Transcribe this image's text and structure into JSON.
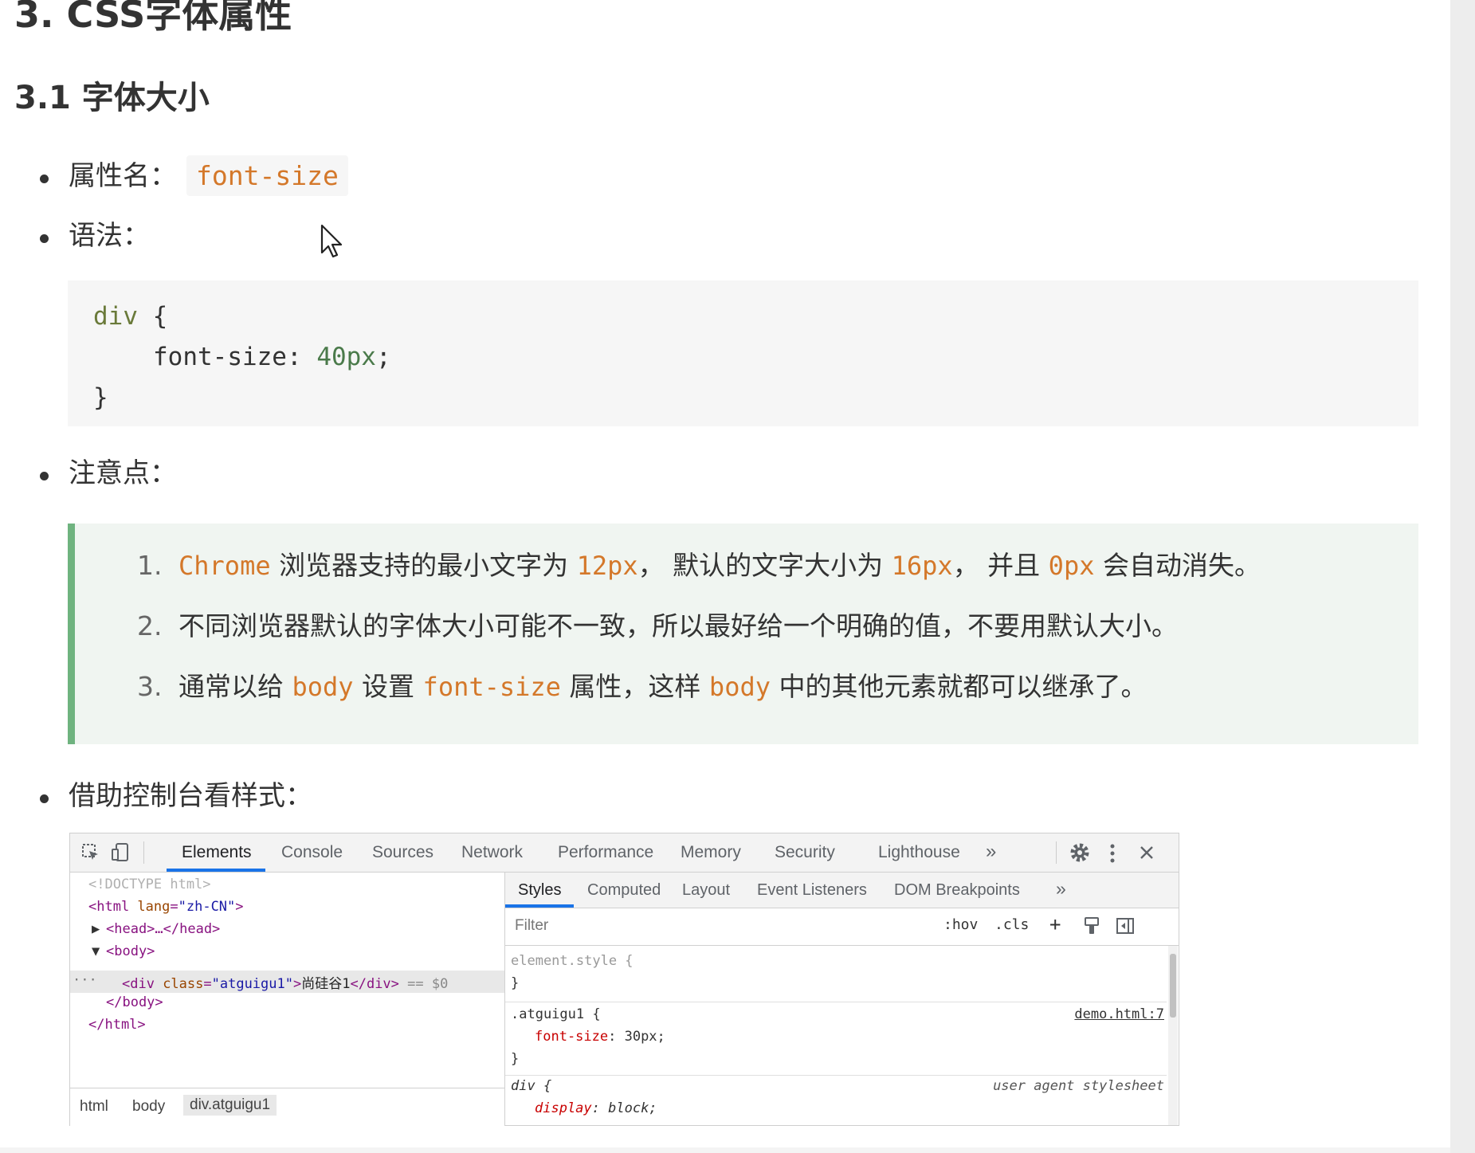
{
  "headings": {
    "h1": "3. CSS字体属性",
    "h2": "3.1 字体大小"
  },
  "bullets": {
    "prop_label": "属性名：",
    "prop_value": "font-size",
    "syntax_label": "语法：",
    "notes_label": "注意点：",
    "console_label": "借助控制台看样式："
  },
  "code": {
    "line1_kw": "div",
    "line1_rest": " {",
    "line2_prop": "font-size",
    "line2_colon": ": ",
    "line2_val": "40px",
    "line2_end": ";",
    "line3": "}"
  },
  "notes": [
    {
      "num": "1.",
      "a": "Chrome",
      "b": " 浏览器支持的最小文字为 ",
      "c": "12px",
      "d": "， 默认的文字大小为 ",
      "e": "16px",
      "f": "， 并且 ",
      "g": "0px",
      "h": " 会自动消失。"
    },
    {
      "num": "2.",
      "text": "不同浏览器默认的字体大小可能不一致，所以最好给一个明确的值，不要用默认大小。"
    },
    {
      "num": "3.",
      "a": "通常以给 ",
      "b": "body",
      "c": " 设置 ",
      "d": "font-size",
      "e": " 属性，这样 ",
      "f": "body",
      "g": " 中的其他元素就都可以继承了。"
    }
  ],
  "devtools": {
    "tabs": [
      "Elements",
      "Console",
      "Sources",
      "Network",
      "Performance",
      "Memory",
      "Security",
      "Lighthouse"
    ],
    "more": "»",
    "dom": {
      "doctype": "<!DOCTYPE html>",
      "html_open_tag": "<html ",
      "html_attr": "lang",
      "html_eq": "=",
      "html_val": "\"zh-CN\"",
      "html_close": ">",
      "head": "<head>…</head>",
      "body_open": "<body>",
      "div_tag": "<div ",
      "div_attr": "class",
      "div_eq": "=",
      "div_val": "\"atguigu1\"",
      "div_gt": ">",
      "div_text": "尚硅谷1",
      "div_close": "</div>",
      "div_marker": " == $0",
      "ellipsis": "···",
      "body_close": "</body>",
      "html_close_tag": "</html>"
    },
    "breadcrumbs": [
      "html",
      "body",
      "div.atguigu1"
    ],
    "subtabs": [
      "Styles",
      "Computed",
      "Layout",
      "Event Listeners",
      "DOM Breakpoints"
    ],
    "sub_more": "»",
    "filter_placeholder": "Filter",
    "hov": ":hov",
    "cls": ".cls",
    "plus": "+",
    "rules": {
      "element_style": "element.style {",
      "close1": "}",
      "selector2": ".atguigu1 {",
      "source2": "demo.html:7",
      "prop2": "font-size",
      "val2": ": 30px;",
      "close2": "}",
      "selector3": "div {",
      "source3": "user agent stylesheet",
      "prop3": "display",
      "val3": ": block;"
    }
  },
  "colors": {
    "code_orange": "#d4782a",
    "quote_border": "#6fb37f",
    "devtools_blue": "#1a73e8"
  }
}
